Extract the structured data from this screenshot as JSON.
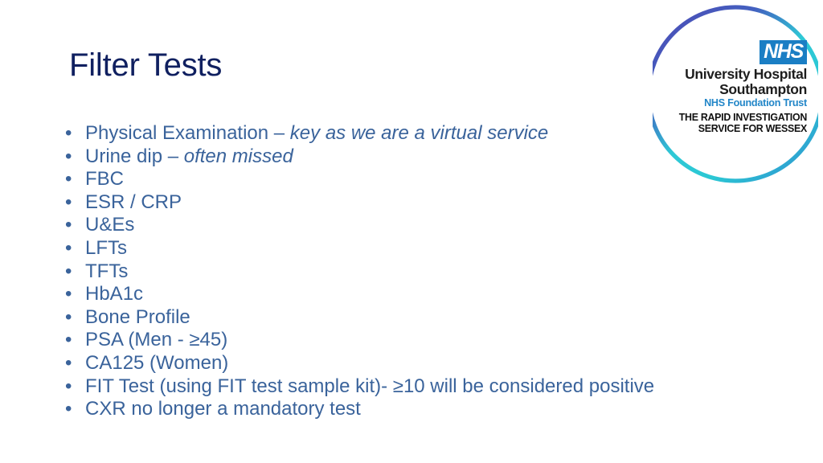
{
  "slide": {
    "title": "Filter Tests",
    "title_color": "#102060",
    "body_color": "#3a639b",
    "background": "#ffffff",
    "bullet_glyph": "•",
    "bullets": [
      {
        "text": "Physical Examination – ",
        "emphasis": "key as we are a virtual service"
      },
      {
        "text": "Urine dip – ",
        "emphasis": "often missed"
      },
      {
        "text": "FBC",
        "emphasis": ""
      },
      {
        "text": "ESR / CRP",
        "emphasis": ""
      },
      {
        "text": "U&Es",
        "emphasis": ""
      },
      {
        "text": "LFTs",
        "emphasis": ""
      },
      {
        "text": "TFTs",
        "emphasis": ""
      },
      {
        "text": "HbA1c",
        "emphasis": ""
      },
      {
        "text": "Bone Profile",
        "emphasis": ""
      },
      {
        "text": "PSA (Men - ≥45)",
        "emphasis": ""
      },
      {
        "text": "CA125 (Women)",
        "emphasis": ""
      },
      {
        "text": "FIT Test (using FIT test sample kit)- ≥10 will be considered positive",
        "emphasis": ""
      },
      {
        "text": "CXR no longer a mandatory test",
        "emphasis": ""
      }
    ]
  },
  "logo": {
    "nhs_mark": "NHS",
    "trust_name_line1": "University Hospital",
    "trust_name_line2": "Southampton",
    "trust_sub": "NHS Foundation Trust",
    "service_line1": "THE RAPID INVESTIGATION",
    "service_line2": "SERVICE FOR WESSEX",
    "nhs_blue": "#1a7ec4",
    "ring_color_start": "#4a50b6",
    "ring_color_mid": "#27d2d4",
    "ring_color_end": "#2f9ed2"
  }
}
